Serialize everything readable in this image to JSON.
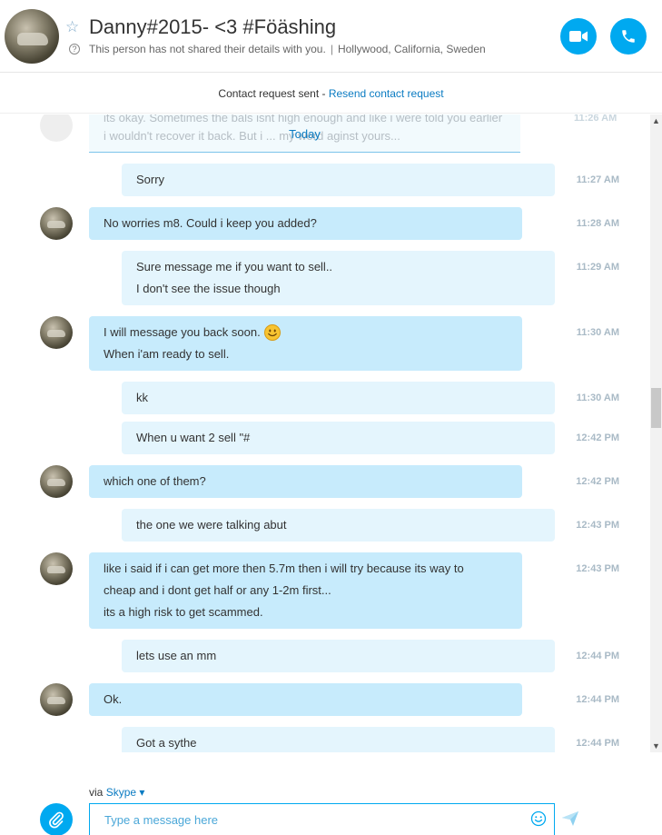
{
  "header": {
    "contact_name": "Danny#2015- <3 #Föäshing",
    "details_note": "This person has not shared their details with you.",
    "separator": "|",
    "location": "Hollywood, California, Sweden"
  },
  "request_bar": {
    "status": "Contact request sent - ",
    "link": "Resend contact request"
  },
  "chat": {
    "ghost_text": "its okay. Sometimes the bals isnt high enough and like i were told you earlier i wouldn't recover it back. But i ... my word aginst yours...",
    "ghost_time": "11:26 AM",
    "date_separator": "Today",
    "messages": [
      {
        "dir": "out",
        "lines": [
          "Sorry"
        ],
        "time": "11:27 AM"
      },
      {
        "dir": "in",
        "lines": [
          "No worries m8. Could i keep you added?"
        ],
        "time": "11:28 AM"
      },
      {
        "dir": "out",
        "lines": [
          "Sure message me if you want to sell..",
          "I don't see the issue though"
        ],
        "time": "11:29 AM"
      },
      {
        "dir": "in",
        "lines": [
          "I will message you back soon.",
          "When i'am ready to sell."
        ],
        "time": "11:30 AM",
        "emoji": "smiley"
      },
      {
        "dir": "out",
        "lines": [
          "kk"
        ],
        "time": "11:30 AM"
      },
      {
        "dir": "out",
        "lines": [
          "When u want 2 sell \"#"
        ],
        "time": "12:42 PM"
      },
      {
        "dir": "in",
        "lines": [
          "which one of them?"
        ],
        "time": "12:42 PM"
      },
      {
        "dir": "out",
        "lines": [
          "the one we were talking abut"
        ],
        "time": "12:43 PM"
      },
      {
        "dir": "in",
        "lines": [
          "like i said if i can get more then 5.7m then i will try because its way to",
          "cheap and i dont get half or any 1-2m first...",
          "its a high risk to get scammed."
        ],
        "time": "12:43 PM"
      },
      {
        "dir": "out",
        "lines": [
          "lets use an mm"
        ],
        "time": "12:44 PM"
      },
      {
        "dir": "in",
        "lines": [
          "Ok."
        ],
        "time": "12:44 PM"
      },
      {
        "dir": "out",
        "lines": [
          "Got a sythe"
        ],
        "time": "12:44 PM"
      }
    ]
  },
  "compose": {
    "via_label": "via ",
    "via_service": "Skype",
    "placeholder": "Type a message here"
  },
  "colors": {
    "accent": "#00a9f0",
    "incoming_bubble": "#c7ebfc",
    "outgoing_bubble": "#e4f5fd",
    "link": "#0a7bc2"
  }
}
